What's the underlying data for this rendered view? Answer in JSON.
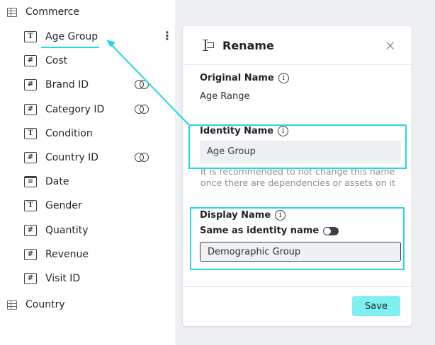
{
  "tree": {
    "tables": [
      {
        "name": "Commerce"
      },
      {
        "name": "Country"
      }
    ],
    "fields": [
      {
        "label": "Age Group",
        "type": "T",
        "linked": false,
        "selected": true
      },
      {
        "label": "Cost",
        "type": "#",
        "linked": false
      },
      {
        "label": "Brand ID",
        "type": "#",
        "linked": true
      },
      {
        "label": "Category ID",
        "type": "#",
        "linked": true
      },
      {
        "label": "Condition",
        "type": "T",
        "linked": false
      },
      {
        "label": "Country ID",
        "type": "#",
        "linked": true
      },
      {
        "label": "Date",
        "type": "date",
        "linked": false
      },
      {
        "label": "Gender",
        "type": "T",
        "linked": false
      },
      {
        "label": "Quantity",
        "type": "#",
        "linked": false
      },
      {
        "label": "Revenue",
        "type": "#",
        "linked": false
      },
      {
        "label": "Visit ID",
        "type": "#",
        "linked": false
      }
    ],
    "menu_glyph": "⋮"
  },
  "panel": {
    "title": "Rename",
    "close_glyph": "×",
    "original_name_label": "Original Name",
    "original_name_value": "Age Range",
    "identity_name_label": "Identity Name",
    "identity_name_value": "Age Group",
    "identity_hint": "It is recommended to not change this name once there are dependencies or assets on it",
    "display_name_label": "Display Name",
    "same_as_identity_label": "Same as identity name",
    "same_as_identity_on": false,
    "display_name_value": "Demographic Group",
    "save_label": "Save",
    "info_glyph": "i"
  },
  "colors": {
    "accent": "#26d6e4",
    "save_button": "#7ff0f2",
    "panel_background": "#eef0f3"
  }
}
